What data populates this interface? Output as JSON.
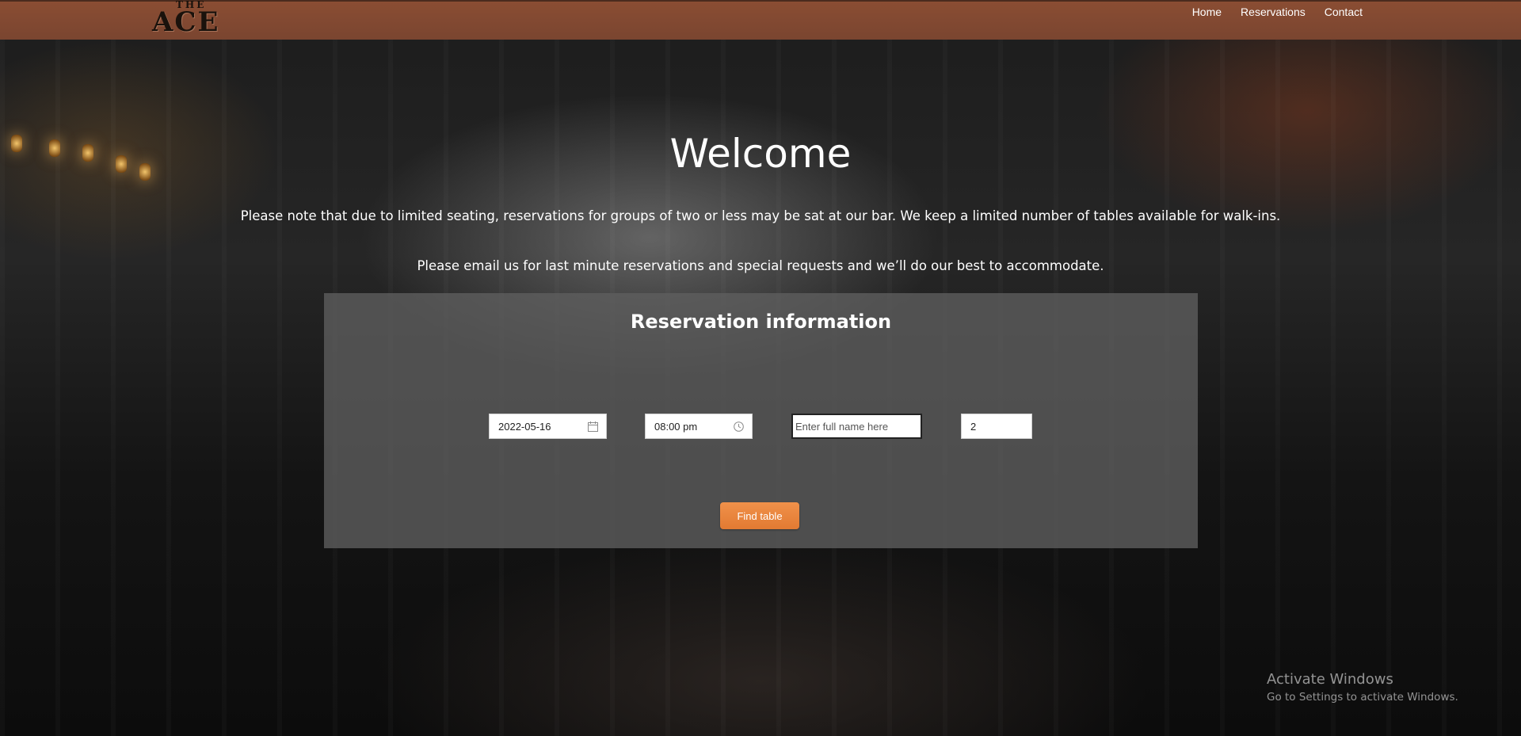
{
  "header": {
    "logo_top": "THE",
    "logo_main": "ACE",
    "nav": [
      "Home",
      "Reservations",
      "Contact"
    ]
  },
  "hero": {
    "title": "Welcome",
    "note_1": "Please note that due to limited seating, reservations for groups of two or less may be sat at our bar. We keep a limited number of tables available for walk-ins.",
    "note_2": "Please email us for last minute reservations and special requests and we’ll do our best to accommodate."
  },
  "reservation": {
    "title": "Reservation information",
    "date_value": "2022-05-16",
    "date_icon": "calendar-icon",
    "time_value": "08:00 pm",
    "time_icon": "clock-icon",
    "name_placeholder": "Enter full name here",
    "party_size": "2",
    "find_button": "Find table"
  },
  "colors": {
    "header_bg": "#8a4d33",
    "button_bg": "#e8853d",
    "panel_bg": "#5f5f5f"
  },
  "watermark": {
    "title": "Activate Windows",
    "subtitle": "Go to Settings to activate Windows."
  }
}
